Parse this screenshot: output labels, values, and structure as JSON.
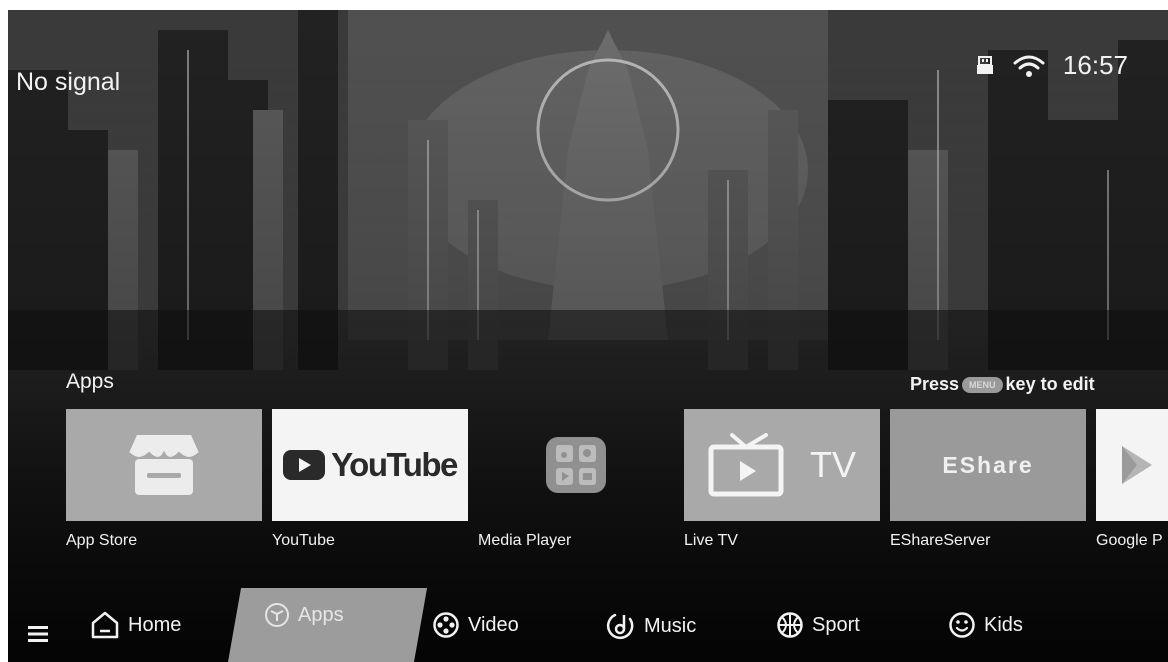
{
  "status": {
    "signal_text": "No signal",
    "clock": "16:57",
    "icons": [
      "usb-icon",
      "wifi-icon"
    ]
  },
  "apps_section": {
    "title": "Apps",
    "edit_hint_prefix": "Press",
    "edit_hint_key": "MENU",
    "edit_hint_suffix": "key to edit"
  },
  "apps": [
    {
      "label": "App Store",
      "icon": "store-icon"
    },
    {
      "label": "YouTube",
      "icon": "youtube-logo-icon",
      "logo_text": "YouTube"
    },
    {
      "label": "Media Player",
      "icon": "media-player-icon"
    },
    {
      "label": "Live TV",
      "icon": "tv-icon",
      "logo_text": "TV"
    },
    {
      "label": "EShareServer",
      "icon": "eshare-logo-icon",
      "logo_text": "EShare"
    },
    {
      "label": "Google P",
      "icon": "play-triangle-icon"
    }
  ],
  "nav": {
    "items": [
      {
        "label": "Home",
        "icon": "home-icon"
      },
      {
        "label": "Apps",
        "icon": "apps-cube-icon",
        "active": true
      },
      {
        "label": "Video",
        "icon": "video-reel-icon"
      },
      {
        "label": "Music",
        "icon": "music-note-icon"
      },
      {
        "label": "Sport",
        "icon": "ball-icon"
      },
      {
        "label": "Kids",
        "icon": "smiley-icon"
      }
    ],
    "menu_icon": "hamburger-menu-icon"
  },
  "colors": {
    "tile_gray": "#a9a9a9",
    "tile_white": "#f4f4f4",
    "nav_active": "#9c9c9c"
  }
}
